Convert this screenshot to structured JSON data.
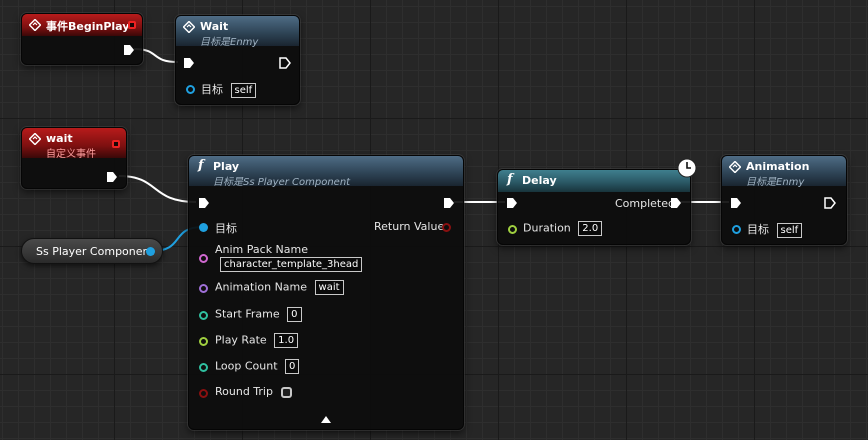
{
  "colors": {
    "exec": "#ffffff",
    "object_pin": "#1fa0e0",
    "string_pin": "#d068d0",
    "name_pin": "#a070d8",
    "int_pin": "#30c0a0",
    "float_pin": "#a0d040",
    "bool_pin": "#8a1010",
    "event_header": "#b81b1b",
    "function_header": "#3d5a72"
  },
  "nodes": {
    "begin_play": {
      "title": "事件BeginPlay",
      "icon": "event-diamond-icon"
    },
    "wait_top": {
      "title": "Wait",
      "subtitle": "目标是Enmy",
      "icon": "event-diamond-icon",
      "target_label": "目标",
      "target_value": "self"
    },
    "wait_event": {
      "title": "wait",
      "subtitle": "自定义事件",
      "icon": "event-diamond-icon"
    },
    "play": {
      "title": "Play",
      "subtitle": "目标是Ss Player Component",
      "icon": "function-icon",
      "target_label": "目标",
      "return_label": "Return Value",
      "anim_pack_label": "Anim Pack Name",
      "anim_pack_value": "character_template_3head",
      "animation_name_label": "Animation Name",
      "animation_name_value": "wait",
      "start_frame_label": "Start Frame",
      "start_frame_value": "0",
      "play_rate_label": "Play Rate",
      "play_rate_value": "1.0",
      "loop_count_label": "Loop Count",
      "loop_count_value": "0",
      "round_trip_label": "Round Trip"
    },
    "delay": {
      "title": "Delay",
      "icon": "function-icon",
      "completed_label": "Completed",
      "duration_label": "Duration",
      "duration_value": "2.0"
    },
    "animation": {
      "title": "Animation",
      "subtitle": "目标是Enmy",
      "icon": "event-diamond-icon",
      "target_label": "目标",
      "target_value": "self"
    },
    "ss_player_component": {
      "label": "Ss Player Component"
    }
  }
}
